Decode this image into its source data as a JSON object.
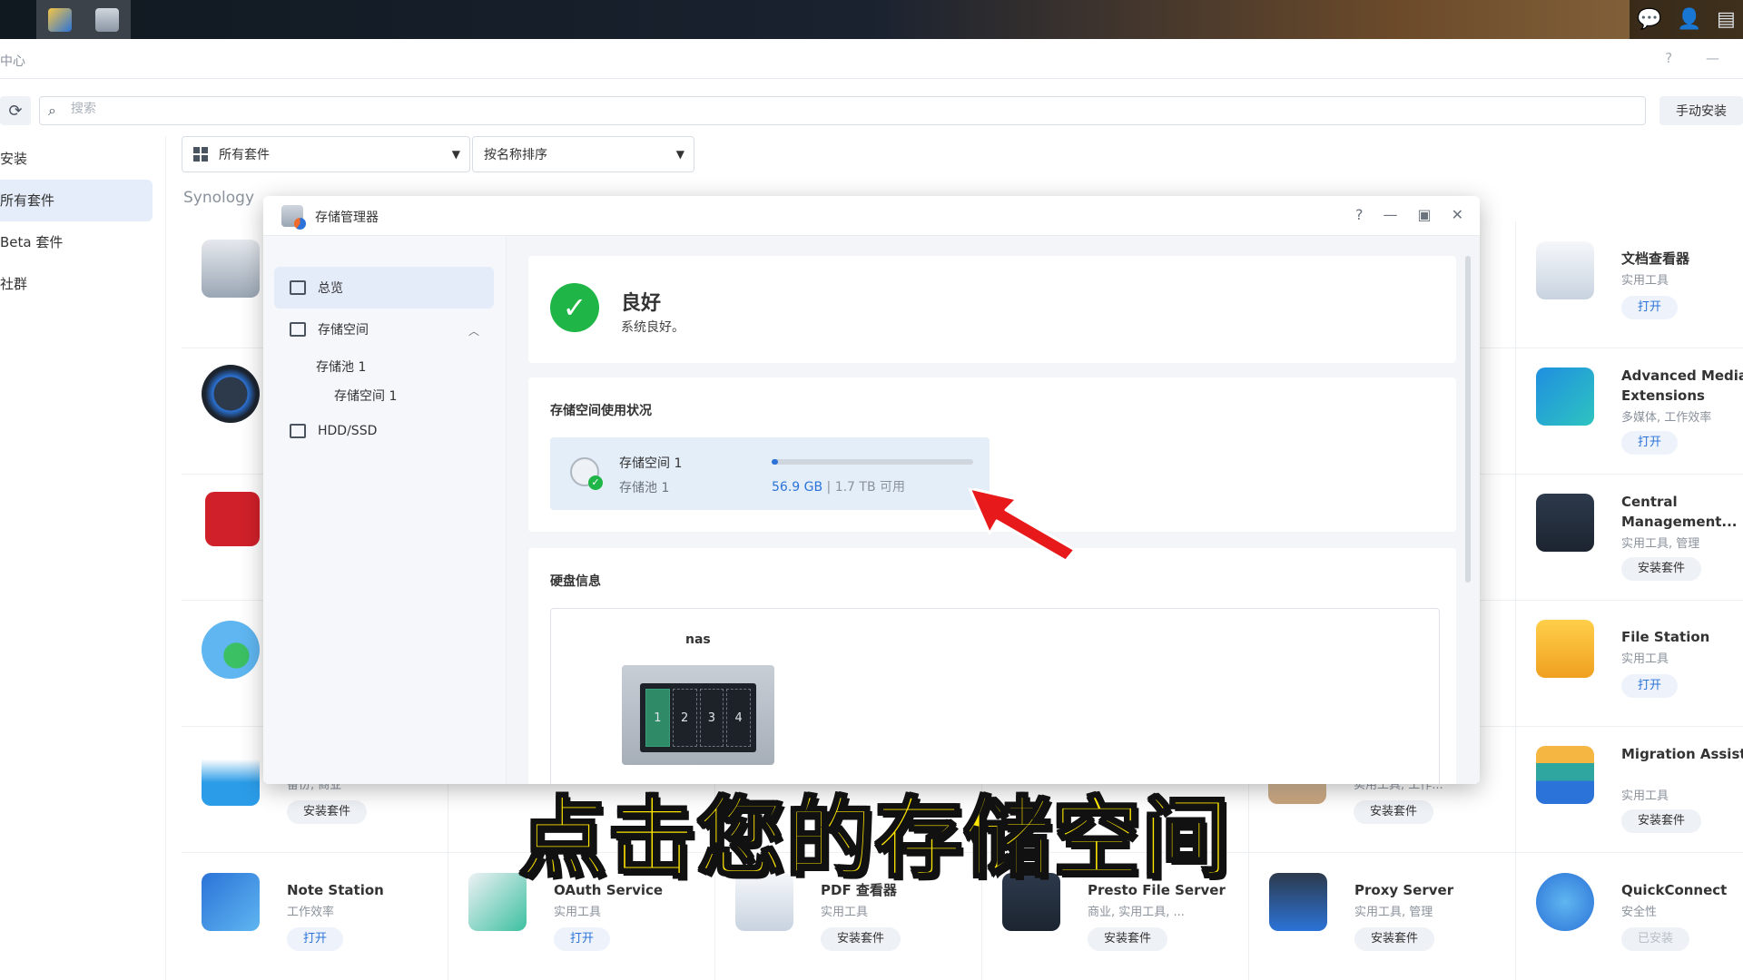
{
  "taskbar": {
    "apps": [
      "package-center-icon",
      "storage-manager-icon"
    ],
    "right_icons": [
      "chat-icon",
      "user-icon",
      "widget-icon"
    ]
  },
  "package_center": {
    "title": "中心",
    "search": {
      "placeholder": "搜索"
    },
    "manual_install_label": "手动安装",
    "left_nav": [
      {
        "label": "安装"
      },
      {
        "label": "所有套件"
      },
      {
        "label": "Beta 套件"
      },
      {
        "label": "社群"
      }
    ],
    "filter_all": "所有套件",
    "sort_by": "按名称排序",
    "section_label": "Synology",
    "packages": [
      {
        "name": "Note Station",
        "category": "工作效率",
        "button": "打开",
        "state": "open"
      },
      {
        "name": "OAuth Service",
        "category": "实用工具",
        "button": "打开",
        "state": "open"
      },
      {
        "name": "PDF 查看器",
        "category": "实用工具",
        "button": "安装套件",
        "state": "install"
      },
      {
        "name": "Presto File Server",
        "category": "商业, 实用工具, ...",
        "button": "安装套件",
        "state": "install"
      },
      {
        "name": "Proxy Server",
        "category": "实用工具, 管理",
        "button": "安装套件",
        "state": "install"
      },
      {
        "name": "QuickConnect",
        "category": "安全性",
        "button": "已安装",
        "state": "installed"
      },
      {
        "name": "文档查看器",
        "category": "实用工具",
        "button": "打开",
        "state": "open"
      },
      {
        "name": "Advanced Media Extensions",
        "category": "多媒体, 工作效率",
        "button": "打开",
        "state": "open"
      },
      {
        "name": "Central Management...",
        "category": "实用工具, 管理",
        "button": "安装套件",
        "state": "install"
      },
      {
        "name": "File Station",
        "category": "实用工具",
        "button": "打开",
        "state": "open"
      },
      {
        "name": "Migration Assistant",
        "category": "实用工具",
        "button": "安装套件",
        "state": "install"
      },
      {
        "name": "",
        "category": "备份, 商业",
        "button": "安装套件",
        "state": "install"
      },
      {
        "name": "",
        "category": "实用工具, 工作...",
        "button": "安装套件",
        "state": "install"
      }
    ]
  },
  "storage_manager": {
    "title": "存储管理器",
    "side": {
      "overview": "总览",
      "storage": "存储空间",
      "pool": "存储池 1",
      "volume": "存储空间 1",
      "hdd": "HDD/SSD"
    },
    "status": {
      "title": "良好",
      "subtitle": "系统良好。"
    },
    "usage": {
      "heading": "存储空间使用状况",
      "volume_name": "存储空间 1",
      "pool_name": "存储池 1",
      "used": "56.9 GB",
      "separator": "|",
      "available": "1.7 TB 可用",
      "used_fraction": 0.03
    },
    "disk": {
      "heading": "硬盘信息",
      "device_name": "nas",
      "bays": [
        "1",
        "2",
        "3",
        "4"
      ]
    }
  },
  "subtitle": "点击您的存储空间",
  "colors": {
    "accent": "#2b73d8",
    "success": "#1fb547",
    "annotation": "#e8191a",
    "subtitle": "#ffe600"
  }
}
